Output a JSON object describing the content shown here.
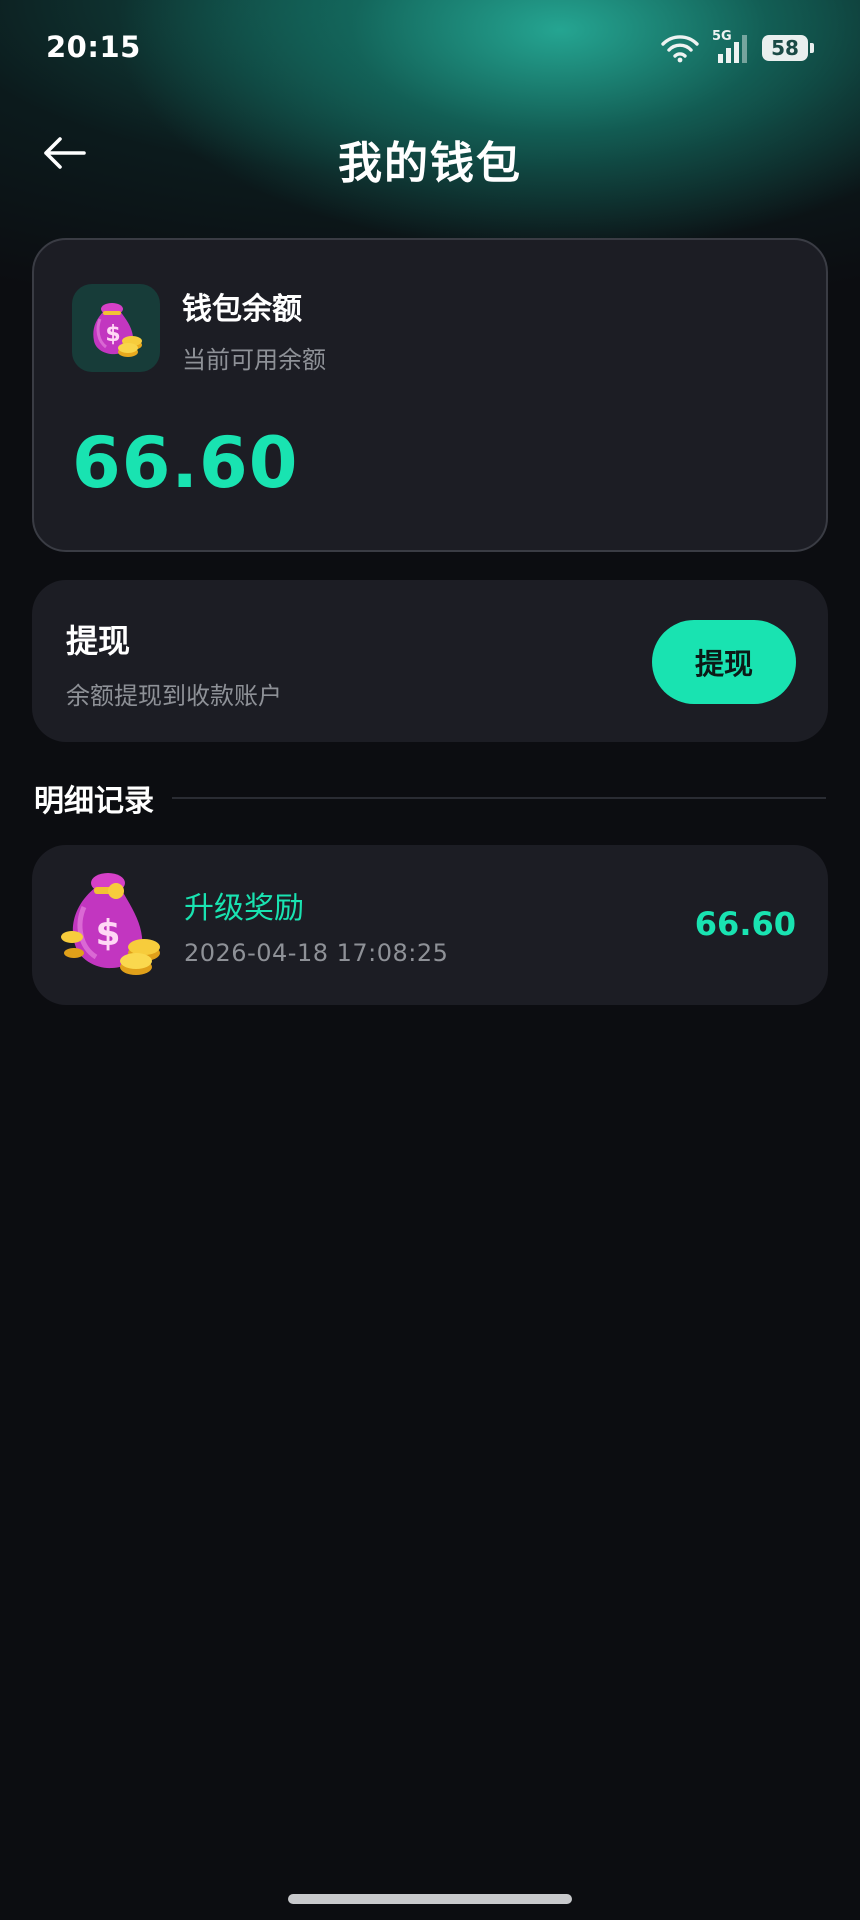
{
  "status_bar": {
    "time": "20:15",
    "network": "5G",
    "battery": "58"
  },
  "nav": {
    "title": "我的钱包",
    "back_icon": "arrow-left-icon"
  },
  "balance_card": {
    "title": "钱包余额",
    "subtitle": "当前可用余额",
    "amount": "66.60",
    "icon": "money-bag-icon"
  },
  "withdraw": {
    "title": "提现",
    "subtitle": "余额提现到收款账户",
    "button_label": "提现"
  },
  "records": {
    "section_title": "明细记录",
    "items": [
      {
        "title": "升级奖励",
        "time": "2026-04-18 17:08:25",
        "amount": "66.60",
        "icon": "money-bag-icon"
      }
    ]
  },
  "colors": {
    "accent": "#19e3b1",
    "background": "#0c0d11",
    "card": "#1c1d24",
    "muted_text": "#8e9197"
  }
}
